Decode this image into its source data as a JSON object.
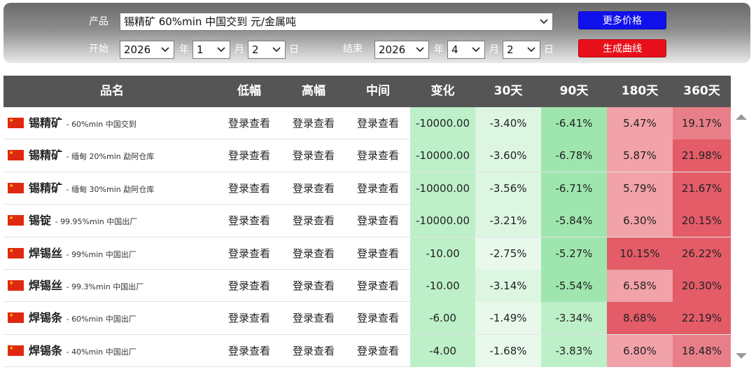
{
  "filters": {
    "product_label": "产品",
    "product_value": "锡精矿 60%min 中国交到 元/金属吨",
    "more_prices_label": "更多价格",
    "start_label": "开始",
    "end_label": "结束",
    "year_unit": "年",
    "month_unit": "月",
    "day_unit": "日",
    "start": {
      "year": "2026",
      "month": "1",
      "day": "2"
    },
    "end": {
      "year": "2026",
      "month": "4",
      "day": "2"
    },
    "generate_label": "生成曲线"
  },
  "table": {
    "columns": [
      "品名",
      "低幅",
      "高幅",
      "中间",
      "变化",
      "30天",
      "90天",
      "180天",
      "360天"
    ],
    "rows": [
      {
        "name": "锡精矿",
        "desc": "60%min 中国交到",
        "low": "登录查看",
        "high": "登录查看",
        "mid": "登录查看",
        "change": "-10000.00",
        "d30": "-3.40%",
        "d90": "-6.41%",
        "d180": "5.47%",
        "d360": "19.17%"
      },
      {
        "name": "锡精矿",
        "desc": "缅甸 20%min 勐阿仓库",
        "low": "登录查看",
        "high": "登录查看",
        "mid": "登录查看",
        "change": "-10000.00",
        "d30": "-3.60%",
        "d90": "-6.78%",
        "d180": "5.87%",
        "d360": "21.98%"
      },
      {
        "name": "锡精矿",
        "desc": "缅甸 30%min 勐阿仓库",
        "low": "登录查看",
        "high": "登录查看",
        "mid": "登录查看",
        "change": "-10000.00",
        "d30": "-3.56%",
        "d90": "-6.71%",
        "d180": "5.79%",
        "d360": "21.67%"
      },
      {
        "name": "锡锭",
        "desc": "99.95%min 中国出厂",
        "low": "登录查看",
        "high": "登录查看",
        "mid": "登录查看",
        "change": "-10000.00",
        "d30": "-3.21%",
        "d90": "-5.84%",
        "d180": "6.30%",
        "d360": "20.15%"
      },
      {
        "name": "焊锡丝",
        "desc": "99%min 中国出厂",
        "low": "登录查看",
        "high": "登录查看",
        "mid": "登录查看",
        "change": "-10.00",
        "d30": "-2.75%",
        "d90": "-5.27%",
        "d180": "10.15%",
        "d360": "26.22%"
      },
      {
        "name": "焊锡丝",
        "desc": "99.3%min 中国出厂",
        "low": "登录查看",
        "high": "登录查看",
        "mid": "登录查看",
        "change": "-10.00",
        "d30": "-3.14%",
        "d90": "-5.54%",
        "d180": "6.58%",
        "d360": "20.30%"
      },
      {
        "name": "焊锡条",
        "desc": "60%min 中国出厂",
        "low": "登录查看",
        "high": "登录查看",
        "mid": "登录查看",
        "change": "-6.00",
        "d30": "-1.49%",
        "d90": "-3.34%",
        "d180": "8.68%",
        "d360": "22.19%"
      },
      {
        "name": "焊锡条",
        "desc": "40%min 中国出厂",
        "low": "登录查看",
        "high": "登录查看",
        "mid": "登录查看",
        "change": "-4.00",
        "d30": "-1.68%",
        "d90": "-3.83%",
        "d180": "6.80%",
        "d360": "18.48%"
      }
    ]
  },
  "flag_symbol": "★",
  "icons": {
    "dropdown": "chevron-down-icon",
    "flag": "china-flag-icon",
    "scroll_up": "scroll-up-arrow-icon",
    "scroll_down": "scroll-down-arrow-icon"
  },
  "colors": {
    "header_bg": "#555555",
    "more_button": "#1111ee",
    "generate_button": "#e8101a",
    "negative_strong": "#9ee6ae",
    "negative_medium": "#bdf0c8",
    "negative_light": "#dcf6e2",
    "positive_light": "#f2a2a9",
    "positive_strong": "#e35c68"
  }
}
